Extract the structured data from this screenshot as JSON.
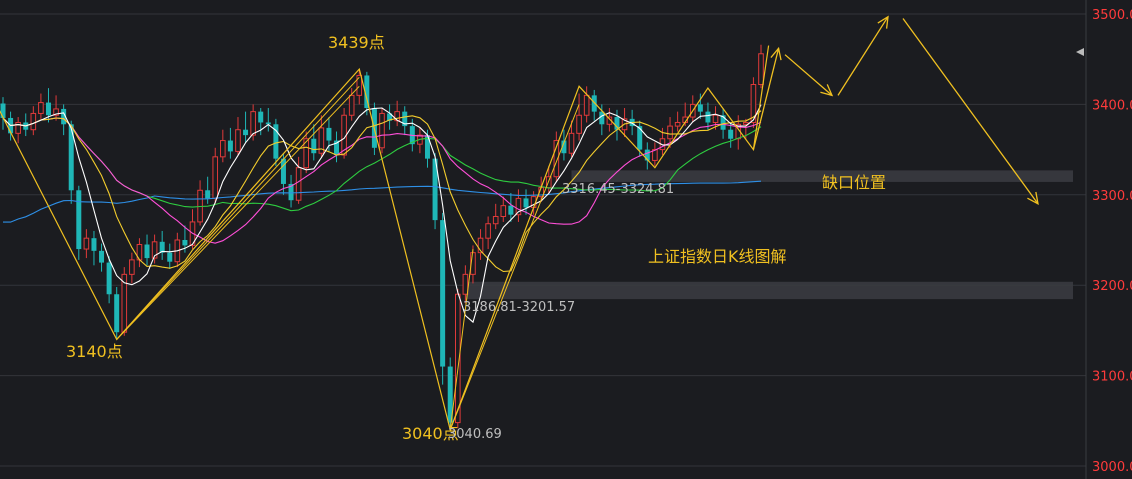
{
  "chart_data": {
    "type": "candlestick",
    "title": "上证指数日K线图解",
    "ylim": [
      3000,
      3500
    ],
    "yticks": [
      "3500.00",
      "3400.00",
      "3300.00",
      "3200.00",
      "3100.00",
      "3000.00"
    ],
    "ytick_values": [
      3500,
      3400,
      3300,
      3200,
      3100,
      3000
    ],
    "grid": true,
    "colors": {
      "background": "#1b1c20",
      "up": "#e03a3a",
      "down": "#1fb7b7",
      "axis_label": "#ff3b3b",
      "annotation": "#f0c020",
      "ma5": "#ffffff",
      "ma10": "#f2cc2d",
      "ma20": "#ff4fd8",
      "ma30": "#2ecc40",
      "ma60": "#2e8fe6"
    },
    "candles": [
      [
        3401,
        3385,
        3408,
        3372
      ],
      [
        3385,
        3368,
        3392,
        3360
      ],
      [
        3368,
        3380,
        3386,
        3357
      ],
      [
        3380,
        3372,
        3390,
        3365
      ],
      [
        3372,
        3390,
        3398,
        3366
      ],
      [
        3390,
        3402,
        3412,
        3384
      ],
      [
        3402,
        3388,
        3418,
        3380
      ],
      [
        3388,
        3395,
        3410,
        3382
      ],
      [
        3395,
        3378,
        3400,
        3366
      ],
      [
        3378,
        3305,
        3382,
        3290
      ],
      [
        3305,
        3240,
        3310,
        3228
      ],
      [
        3240,
        3252,
        3262,
        3230
      ],
      [
        3252,
        3238,
        3260,
        3222
      ],
      [
        3238,
        3225,
        3246,
        3215
      ],
      [
        3225,
        3190,
        3232,
        3180
      ],
      [
        3190,
        3148,
        3198,
        3140
      ],
      [
        3148,
        3212,
        3220,
        3144
      ],
      [
        3212,
        3228,
        3236,
        3202
      ],
      [
        3228,
        3245,
        3252,
        3220
      ],
      [
        3245,
        3230,
        3256,
        3222
      ],
      [
        3230,
        3248,
        3256,
        3224
      ],
      [
        3248,
        3236,
        3260,
        3228
      ],
      [
        3236,
        3226,
        3246,
        3218
      ],
      [
        3226,
        3250,
        3258,
        3220
      ],
      [
        3250,
        3244,
        3266,
        3236
      ],
      [
        3244,
        3270,
        3284,
        3240
      ],
      [
        3270,
        3305,
        3316,
        3266
      ],
      [
        3305,
        3296,
        3320,
        3290
      ],
      [
        3296,
        3342,
        3352,
        3290
      ],
      [
        3342,
        3360,
        3372,
        3336
      ],
      [
        3360,
        3348,
        3374,
        3340
      ],
      [
        3348,
        3372,
        3386,
        3344
      ],
      [
        3372,
        3366,
        3392,
        3358
      ],
      [
        3366,
        3392,
        3400,
        3360
      ],
      [
        3392,
        3380,
        3396,
        3366
      ],
      [
        3380,
        3378,
        3396,
        3370
      ],
      [
        3378,
        3340,
        3384,
        3332
      ],
      [
        3340,
        3312,
        3346,
        3300
      ],
      [
        3312,
        3294,
        3322,
        3286
      ],
      [
        3294,
        3330,
        3342,
        3290
      ],
      [
        3330,
        3362,
        3370,
        3324
      ],
      [
        3362,
        3346,
        3378,
        3338
      ],
      [
        3346,
        3374,
        3388,
        3342
      ],
      [
        3374,
        3360,
        3386,
        3348
      ],
      [
        3360,
        3344,
        3370,
        3336
      ],
      [
        3344,
        3388,
        3396,
        3340
      ],
      [
        3388,
        3410,
        3418,
        3382
      ],
      [
        3410,
        3432,
        3439,
        3400
      ],
      [
        3432,
        3396,
        3436,
        3388
      ],
      [
        3396,
        3352,
        3402,
        3344
      ],
      [
        3352,
        3390,
        3396,
        3346
      ],
      [
        3390,
        3382,
        3400,
        3372
      ],
      [
        3382,
        3392,
        3404,
        3376
      ],
      [
        3392,
        3376,
        3398,
        3366
      ],
      [
        3376,
        3356,
        3384,
        3348
      ],
      [
        3356,
        3366,
        3374,
        3346
      ],
      [
        3366,
        3340,
        3372,
        3330
      ],
      [
        3340,
        3272,
        3346,
        3262
      ],
      [
        3272,
        3110,
        3280,
        3090
      ],
      [
        3110,
        3048,
        3120,
        3040
      ],
      [
        3048,
        3190,
        3196,
        3042
      ],
      [
        3190,
        3212,
        3222,
        3180
      ],
      [
        3212,
        3236,
        3244,
        3202
      ],
      [
        3236,
        3252,
        3262,
        3228
      ],
      [
        3252,
        3268,
        3276,
        3240
      ],
      [
        3268,
        3276,
        3290,
        3262
      ],
      [
        3276,
        3288,
        3298,
        3270
      ],
      [
        3288,
        3278,
        3302,
        3270
      ],
      [
        3278,
        3296,
        3306,
        3270
      ],
      [
        3296,
        3286,
        3306,
        3278
      ],
      [
        3286,
        3298,
        3304,
        3278
      ],
      [
        3298,
        3308,
        3320,
        3292
      ],
      [
        3308,
        3320,
        3332,
        3300
      ],
      [
        3320,
        3360,
        3370,
        3314
      ],
      [
        3360,
        3346,
        3372,
        3338
      ],
      [
        3346,
        3368,
        3382,
        3342
      ],
      [
        3368,
        3388,
        3412,
        3360
      ],
      [
        3388,
        3410,
        3420,
        3380
      ],
      [
        3410,
        3392,
        3416,
        3382
      ],
      [
        3392,
        3378,
        3400,
        3366
      ],
      [
        3378,
        3386,
        3396,
        3370
      ],
      [
        3386,
        3372,
        3394,
        3360
      ],
      [
        3372,
        3384,
        3396,
        3364
      ],
      [
        3384,
        3376,
        3394,
        3366
      ],
      [
        3376,
        3350,
        3382,
        3342
      ],
      [
        3350,
        3338,
        3358,
        3328
      ],
      [
        3338,
        3350,
        3358,
        3332
      ],
      [
        3350,
        3362,
        3374,
        3344
      ],
      [
        3362,
        3376,
        3386,
        3352
      ],
      [
        3376,
        3380,
        3392,
        3370
      ],
      [
        3380,
        3386,
        3402,
        3376
      ],
      [
        3386,
        3400,
        3410,
        3380
      ],
      [
        3400,
        3392,
        3412,
        3384
      ],
      [
        3392,
        3380,
        3402,
        3372
      ],
      [
        3380,
        3388,
        3398,
        3372
      ],
      [
        3388,
        3372,
        3396,
        3362
      ],
      [
        3372,
        3362,
        3380,
        3352
      ],
      [
        3362,
        3378,
        3388,
        3350
      ],
      [
        3378,
        3380,
        3384,
        3362
      ],
      [
        3380,
        3422,
        3430,
        3374
      ],
      [
        3422,
        3456,
        3466,
        3418
      ]
    ],
    "price_labels": [
      {
        "id": "high-3439",
        "text": "3439点",
        "value": 3439
      },
      {
        "id": "low-3140",
        "text": "3140点",
        "value": 3140
      },
      {
        "id": "low-3040",
        "text": "3040点",
        "value": 3040
      }
    ],
    "gaps": [
      {
        "id": "gap-upper",
        "low": 3316.45,
        "high": 3324.81,
        "text": "3316.45-3324.81"
      },
      {
        "id": "gap-lower",
        "low": 3186.81,
        "high": 3201.57,
        "text": "3186.81-3201.57"
      }
    ],
    "annotations": {
      "low_value": "3040.69",
      "gap_position": "缺口位置"
    },
    "wave_projection": [
      [
        3439,
        3040
      ],
      [
        3462,
        3410
      ],
      [
        3495,
        3290
      ]
    ]
  }
}
